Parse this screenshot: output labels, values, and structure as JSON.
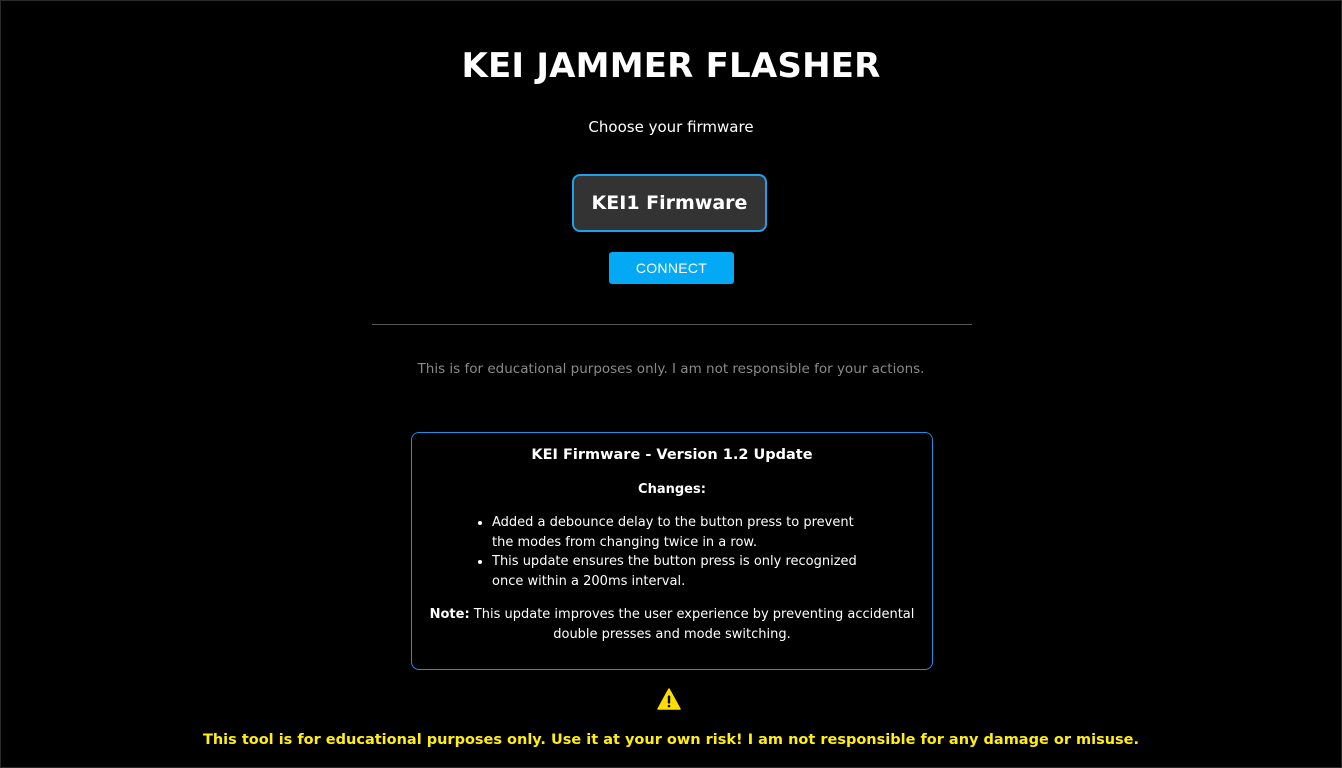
{
  "header": {
    "title": "KEI JAMMER FLASHER",
    "subtitle": "Choose your firmware"
  },
  "firmware": {
    "selected_label": "KEI1 Firmware",
    "connect_label": "CONNECT"
  },
  "disclaimer": "This is for educational purposes only. I am not responsible for your actions.",
  "changelog": {
    "title": "KEI Firmware - Version 1.2 Update",
    "changes_heading": "Changes:",
    "items": [
      "Added a debounce delay to the button press to prevent the modes from changing twice in a row.",
      "This update ensures the button press is only recognized once within a 200ms interval."
    ],
    "note_label": "Note:",
    "note_text": " This update improves the user experience by preventing accidental double presses and mode switching."
  },
  "footer": {
    "icon": "warning-icon",
    "warning_text": "This tool is for educational purposes only. Use it at your own risk! I am not responsible for any damage or misuse."
  },
  "colors": {
    "background": "#000000",
    "accent_border": "#1ea0ea",
    "connect_button": "#03a9f4",
    "warning": "#ffee10",
    "muted_text": "#8a8a8a"
  }
}
